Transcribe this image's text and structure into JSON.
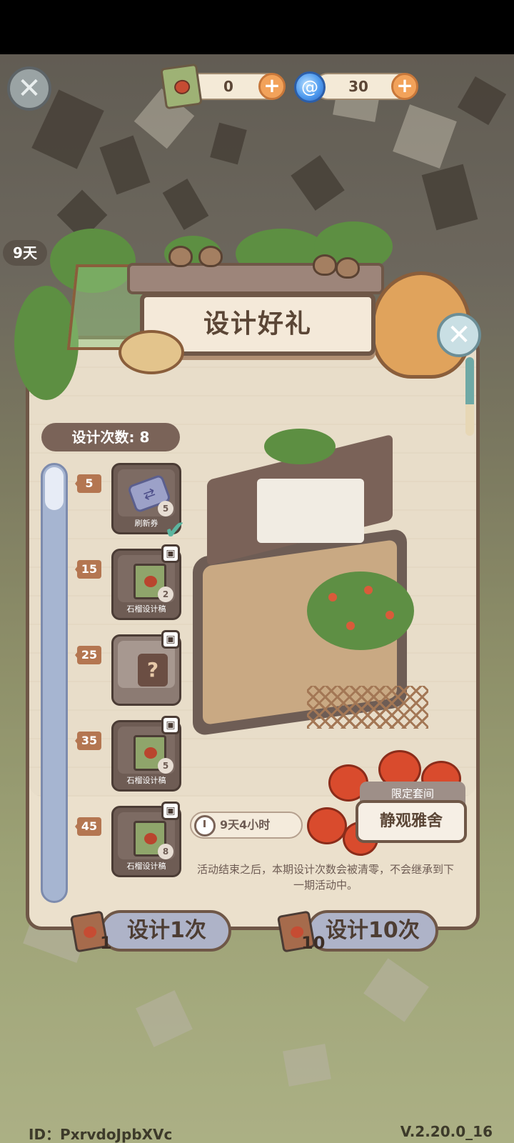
{
  "currencies": {
    "design_scroll": {
      "value": "0",
      "icon": "pomegranate-scroll-icon"
    },
    "swirl": {
      "value": "30",
      "icon": "blue-swirl-icon"
    }
  },
  "background": {
    "day_chip": "9天"
  },
  "panel": {
    "title": "设计好礼",
    "design_count": "设计次数: 8",
    "timer": "9天4小时",
    "suite_badge": "限定套间",
    "suite_name": "静观雅舍",
    "notice": "活动结束之后，本期设计次数会被清零，不会继承到下一期活动中。"
  },
  "milestones": [
    {
      "threshold": "5",
      "label": "刷新券",
      "qty": "5",
      "claimed": true,
      "locked": false
    },
    {
      "threshold": "15",
      "label": "石榴设计稿",
      "qty": "2",
      "claimed": false,
      "locked": true
    },
    {
      "threshold": "25",
      "label": "",
      "qty": "",
      "claimed": false,
      "locked": true
    },
    {
      "threshold": "35",
      "label": "石榴设计稿",
      "qty": "5",
      "claimed": false,
      "locked": true
    },
    {
      "threshold": "45",
      "label": "石榴设计稿",
      "qty": "8",
      "claimed": false,
      "locked": true
    }
  ],
  "actions": {
    "design_once": {
      "label": "设计1次",
      "cost": "1"
    },
    "design_ten": {
      "label": "设计10次",
      "cost": "10"
    }
  },
  "footer": {
    "id": "ID：PxrvdoJpbXVc",
    "version": "V.2.20.0_16"
  }
}
